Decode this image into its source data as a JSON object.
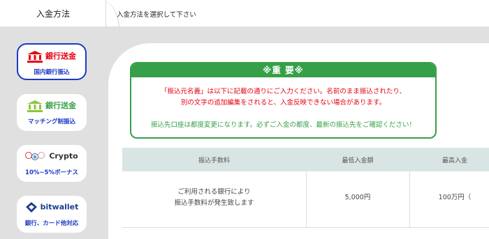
{
  "header": {
    "active_tab": "入金方法",
    "instruction": "入金方法を選択して下さい"
  },
  "colors": {
    "accent_blue": "#1b39c4",
    "bank_red": "#e60012",
    "green": "#36a048",
    "header_row": "#d9e5e5"
  },
  "methods": [
    {
      "title": "銀行送金",
      "sub": "国内銀行振込",
      "icon": "bank-icon",
      "selected": true
    },
    {
      "title": "銀行送金",
      "sub": "マッチング制振込",
      "icon": "bank-icon"
    },
    {
      "title": "Crypto",
      "sub": "10%~5%ボーナス",
      "icon": "crypto-coins-icon"
    },
    {
      "title": "bitwallet",
      "sub": "銀行、カード他対応",
      "icon": "bitwallet-logo-icon"
    }
  ],
  "notice": {
    "title": "※重 要※",
    "red_line1": "「振込元名義」は以下に記載の通りにご入力ください。名前のまま振込されたり、",
    "red_line2": "別の文字の追加編集をされると、入金反映できない場合があります。",
    "green_line": "振込先口座は都度変更になります。必ずご入金の都度、最新の振込先をご確認ください！"
  },
  "table": {
    "headers": [
      "振込手数料",
      "最低入金額",
      "最高入金"
    ],
    "row": {
      "fee_line1": "ご利用される銀行により",
      "fee_line2": "振込手数料が発生致します",
      "min": "5,000円",
      "max": "100万円（"
    }
  }
}
